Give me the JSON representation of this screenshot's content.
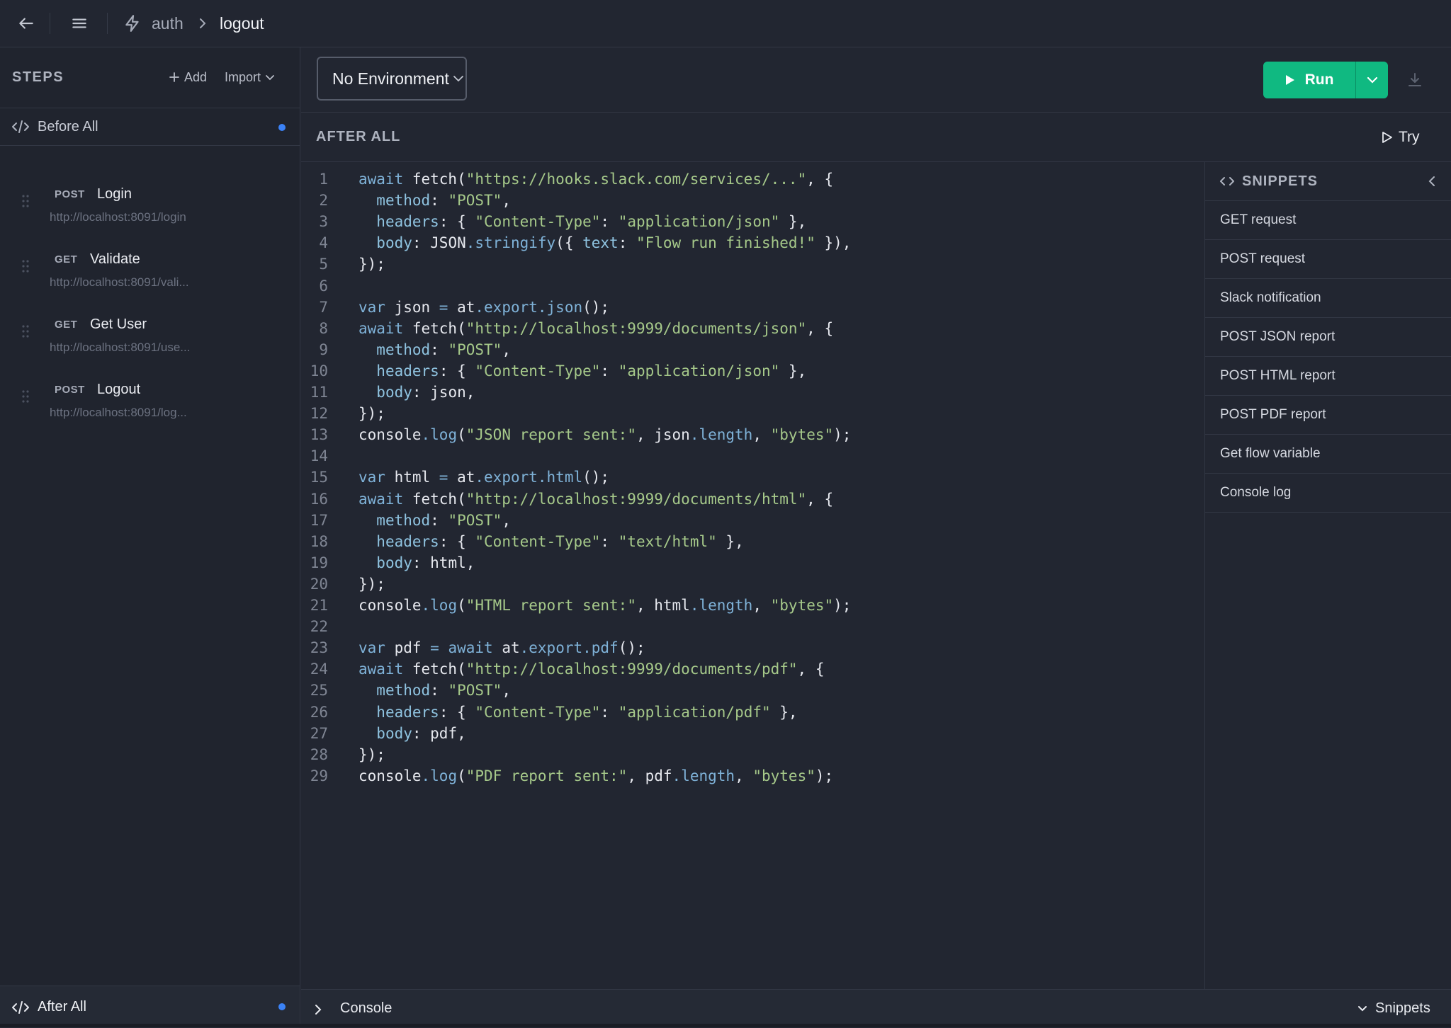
{
  "breadcrumb": {
    "parent": "auth",
    "current": "logout"
  },
  "sidebar": {
    "title": "STEPS",
    "add_label": "Add",
    "import_label": "Import",
    "before_all_label": "Before All",
    "after_all_label": "After All",
    "steps": [
      {
        "method": "POST",
        "name": "Login",
        "url": "http://localhost:8091/login"
      },
      {
        "method": "GET",
        "name": "Validate",
        "url": "http://localhost:8091/vali..."
      },
      {
        "method": "GET",
        "name": "Get User",
        "url": "http://localhost:8091/use..."
      },
      {
        "method": "POST",
        "name": "Logout",
        "url": "http://localhost:8091/log..."
      }
    ]
  },
  "toolbar": {
    "environment": "No Environment",
    "run_label": "Run"
  },
  "section": {
    "title": "AFTER ALL",
    "try_label": "Try"
  },
  "snippets": {
    "title": "SNIPPETS",
    "items": [
      "GET request",
      "POST request",
      "Slack notification",
      "POST JSON report",
      "POST HTML report",
      "POST PDF report",
      "Get flow variable",
      "Console log"
    ]
  },
  "editor": {
    "lines": [
      [
        [
          "kw",
          "await"
        ],
        [
          "t",
          " fetch("
        ],
        [
          "str",
          "\"https://hooks.slack.com/services/...\""
        ],
        [
          "t",
          ", {"
        ]
      ],
      [
        [
          "t",
          "  "
        ],
        [
          "prop",
          "method"
        ],
        [
          "t",
          ": "
        ],
        [
          "str",
          "\"POST\""
        ],
        [
          "t",
          ","
        ]
      ],
      [
        [
          "t",
          "  "
        ],
        [
          "prop",
          "headers"
        ],
        [
          "t",
          ": { "
        ],
        [
          "str",
          "\"Content-Type\""
        ],
        [
          "t",
          ": "
        ],
        [
          "str",
          "\"application/json\""
        ],
        [
          "t",
          " },"
        ]
      ],
      [
        [
          "t",
          "  "
        ],
        [
          "prop",
          "body"
        ],
        [
          "t",
          ": JSON"
        ],
        [
          "mth",
          ".stringify"
        ],
        [
          "t",
          "({ "
        ],
        [
          "prop",
          "text"
        ],
        [
          "t",
          ": "
        ],
        [
          "str",
          "\"Flow run finished!\""
        ],
        [
          "t",
          " }),"
        ]
      ],
      [
        [
          "t",
          "});"
        ]
      ],
      [],
      [
        [
          "kw",
          "var"
        ],
        [
          "t",
          " json "
        ],
        [
          "kw",
          "="
        ],
        [
          "t",
          " at"
        ],
        [
          "mth",
          ".export.json"
        ],
        [
          "t",
          "();"
        ]
      ],
      [
        [
          "kw",
          "await"
        ],
        [
          "t",
          " fetch("
        ],
        [
          "str",
          "\"http://localhost:9999/documents/json\""
        ],
        [
          "t",
          ", {"
        ]
      ],
      [
        [
          "t",
          "  "
        ],
        [
          "prop",
          "method"
        ],
        [
          "t",
          ": "
        ],
        [
          "str",
          "\"POST\""
        ],
        [
          "t",
          ","
        ]
      ],
      [
        [
          "t",
          "  "
        ],
        [
          "prop",
          "headers"
        ],
        [
          "t",
          ": { "
        ],
        [
          "str",
          "\"Content-Type\""
        ],
        [
          "t",
          ": "
        ],
        [
          "str",
          "\"application/json\""
        ],
        [
          "t",
          " },"
        ]
      ],
      [
        [
          "t",
          "  "
        ],
        [
          "prop",
          "body"
        ],
        [
          "t",
          ": json,"
        ]
      ],
      [
        [
          "t",
          "});"
        ]
      ],
      [
        [
          "t",
          "console"
        ],
        [
          "mth",
          ".log"
        ],
        [
          "t",
          "("
        ],
        [
          "str",
          "\"JSON report sent:\""
        ],
        [
          "t",
          ", json"
        ],
        [
          "mth",
          ".length"
        ],
        [
          "t",
          ", "
        ],
        [
          "str",
          "\"bytes\""
        ],
        [
          "t",
          ");"
        ]
      ],
      [],
      [
        [
          "kw",
          "var"
        ],
        [
          "t",
          " html "
        ],
        [
          "kw",
          "="
        ],
        [
          "t",
          " at"
        ],
        [
          "mth",
          ".export.html"
        ],
        [
          "t",
          "();"
        ]
      ],
      [
        [
          "kw",
          "await"
        ],
        [
          "t",
          " fetch("
        ],
        [
          "str",
          "\"http://localhost:9999/documents/html\""
        ],
        [
          "t",
          ", {"
        ]
      ],
      [
        [
          "t",
          "  "
        ],
        [
          "prop",
          "method"
        ],
        [
          "t",
          ": "
        ],
        [
          "str",
          "\"POST\""
        ],
        [
          "t",
          ","
        ]
      ],
      [
        [
          "t",
          "  "
        ],
        [
          "prop",
          "headers"
        ],
        [
          "t",
          ": { "
        ],
        [
          "str",
          "\"Content-Type\""
        ],
        [
          "t",
          ": "
        ],
        [
          "str",
          "\"text/html\""
        ],
        [
          "t",
          " },"
        ]
      ],
      [
        [
          "t",
          "  "
        ],
        [
          "prop",
          "body"
        ],
        [
          "t",
          ": html,"
        ]
      ],
      [
        [
          "t",
          "});"
        ]
      ],
      [
        [
          "t",
          "console"
        ],
        [
          "mth",
          ".log"
        ],
        [
          "t",
          "("
        ],
        [
          "str",
          "\"HTML report sent:\""
        ],
        [
          "t",
          ", html"
        ],
        [
          "mth",
          ".length"
        ],
        [
          "t",
          ", "
        ],
        [
          "str",
          "\"bytes\""
        ],
        [
          "t",
          ");"
        ]
      ],
      [],
      [
        [
          "kw",
          "var"
        ],
        [
          "t",
          " pdf "
        ],
        [
          "kw",
          "="
        ],
        [
          "t",
          " "
        ],
        [
          "kw",
          "await"
        ],
        [
          "t",
          " at"
        ],
        [
          "mth",
          ".export.pdf"
        ],
        [
          "t",
          "();"
        ]
      ],
      [
        [
          "kw",
          "await"
        ],
        [
          "t",
          " fetch("
        ],
        [
          "str",
          "\"http://localhost:9999/documents/pdf\""
        ],
        [
          "t",
          ", {"
        ]
      ],
      [
        [
          "t",
          "  "
        ],
        [
          "prop",
          "method"
        ],
        [
          "t",
          ": "
        ],
        [
          "str",
          "\"POST\""
        ],
        [
          "t",
          ","
        ]
      ],
      [
        [
          "t",
          "  "
        ],
        [
          "prop",
          "headers"
        ],
        [
          "t",
          ": { "
        ],
        [
          "str",
          "\"Content-Type\""
        ],
        [
          "t",
          ": "
        ],
        [
          "str",
          "\"application/pdf\""
        ],
        [
          "t",
          " },"
        ]
      ],
      [
        [
          "t",
          "  "
        ],
        [
          "prop",
          "body"
        ],
        [
          "t",
          ": pdf,"
        ]
      ],
      [
        [
          "t",
          "});"
        ]
      ],
      [
        [
          "t",
          "console"
        ],
        [
          "mth",
          ".log"
        ],
        [
          "t",
          "("
        ],
        [
          "str",
          "\"PDF report sent:\""
        ],
        [
          "t",
          ", pdf"
        ],
        [
          "mth",
          ".length"
        ],
        [
          "t",
          ", "
        ],
        [
          "str",
          "\"bytes\""
        ],
        [
          "t",
          ");"
        ]
      ]
    ]
  },
  "console": {
    "label": "Console",
    "snippets_label": "Snippets"
  },
  "colors": {
    "accent": "#10b981",
    "dot": "#3b82f6",
    "background": "#222631"
  }
}
